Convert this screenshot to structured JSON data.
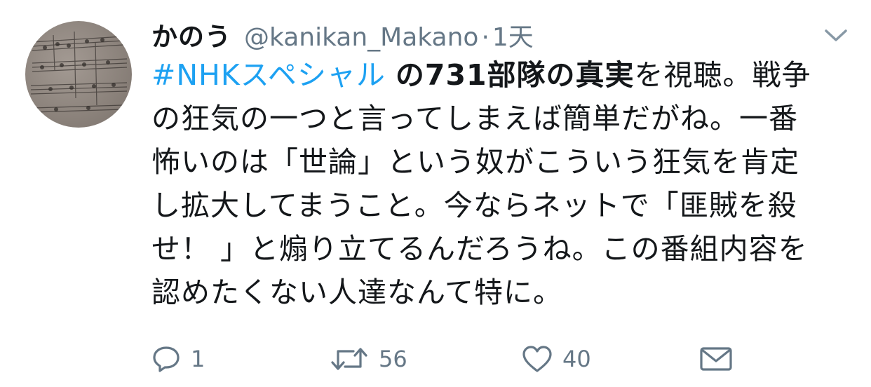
{
  "tweet": {
    "display_name": "かのう",
    "handle": "@kanikan_Makano",
    "separator": "·",
    "time": "1天",
    "body": {
      "line1_hashtag": "#NHKスペシャル",
      "line1_space": " ",
      "line1_bold": "の731部隊の真実",
      "line1_rest": "を視聴。戦争",
      "line2": "の狂気の一つと言ってしまえば簡単だがね。一番",
      "line3": "怖いのは「世論」という奴がこういう狂気を肯定",
      "line4": "し拡大してまうこと。今ならネットで「匪賊を殺",
      "line5": "せ！ 」と煽り立てるんだろうね。この番組内容を",
      "line6": "認めたくない人達なんて特に。"
    },
    "actions": {
      "reply_count": "1",
      "retweet_count": "56",
      "like_count": "40"
    }
  },
  "colors": {
    "text": "#14171a",
    "secondary": "#657786",
    "hashtag": "#1da1f2"
  },
  "icons": [
    "reply-icon",
    "retweet-icon",
    "like-icon",
    "direct-message-icon",
    "chevron-down-icon"
  ]
}
